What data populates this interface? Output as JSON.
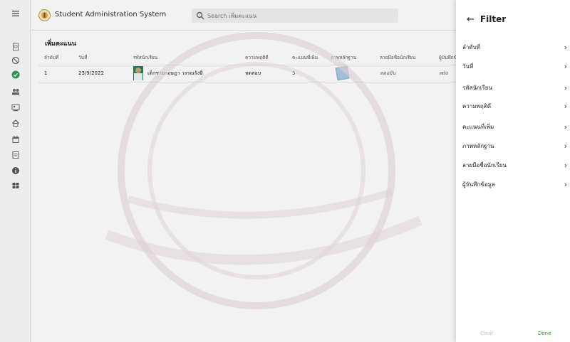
{
  "app": {
    "title": "Student Administration System"
  },
  "search": {
    "placeholder": "Search เพิ่มคะแนน"
  },
  "page": {
    "title": "เพิ่มคะแนน"
  },
  "table": {
    "columns": [
      "ลำดับที่",
      "วันที่",
      "รหัสนักเรียน",
      "ความพฤติดี",
      "คะแนนที่เพิ่ม",
      "ภาพหลักฐาน",
      "ลายมือชื่อนักเรียน",
      "ผู้บันทึกข้อ"
    ],
    "rows": [
      {
        "index": "1",
        "date": "23/9/2022",
        "student": "เด็กชายกฤษฎา วรรณรังษี",
        "behavior": "ทดสอบ",
        "points": "5",
        "signature": "หดอยิน",
        "recorder": "หdo"
      }
    ]
  },
  "filter": {
    "title": "Filter",
    "items": [
      "ลำดับที่",
      "วันที่",
      "รหัสนักเรียน",
      "ความพฤติดี",
      "คะแนนที่เพิ่ม",
      "ภาพหลักฐาน",
      "ลายมือชื่อนักเรียน",
      "ผู้บันทึกข้อมูล"
    ],
    "clear_label": "Clear",
    "done_label": "Done"
  },
  "nav": {
    "icons": [
      "menu-icon",
      "document-icon",
      "block-icon",
      "check-circle-icon",
      "people-icon",
      "contact-icon",
      "home-icon",
      "calendar-icon",
      "badge-icon",
      "info-icon",
      "grid-icon"
    ],
    "active": "check-circle-icon"
  },
  "colors": {
    "accent_green": "#2e9e4f",
    "done_green": "#2e8b3a"
  }
}
